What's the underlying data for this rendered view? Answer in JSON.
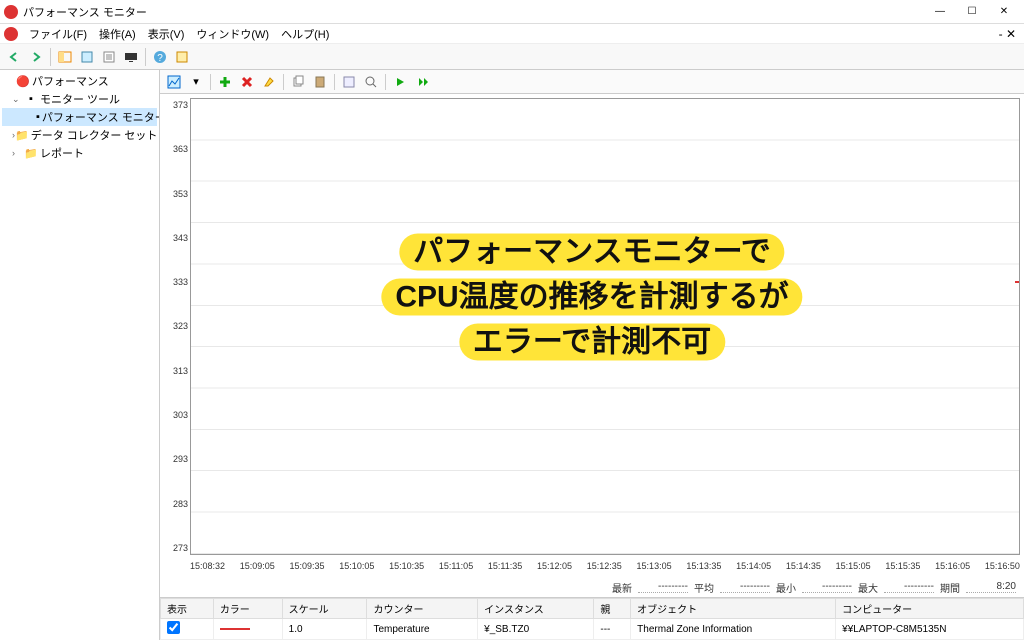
{
  "window": {
    "title": "パフォーマンス モニター"
  },
  "menu": {
    "file": "ファイル(F)",
    "action": "操作(A)",
    "view": "表示(V)",
    "window": "ウィンドウ(W)",
    "help": "ヘルプ(H)"
  },
  "tree": {
    "root": "パフォーマンス",
    "monitor_tools": "モニター ツール",
    "perfmon": "パフォーマンス モニター",
    "collector": "データ コレクター セット",
    "report": "レポート"
  },
  "chart_data": {
    "type": "line",
    "title": "",
    "xlabel": "",
    "ylabel": "",
    "ylim": [
      273,
      373
    ],
    "y_ticks": [
      273,
      283,
      293,
      303,
      313,
      323,
      333,
      343,
      353,
      363,
      373
    ],
    "x_ticks": [
      "15:08:32",
      "15:09:05",
      "15:09:35",
      "15:10:05",
      "15:10:35",
      "15:11:05",
      "15:11:35",
      "15:12:05",
      "15:12:35",
      "15:13:05",
      "15:13:35",
      "15:14:05",
      "15:14:35",
      "15:15:05",
      "15:15:35",
      "15:16:05",
      "15:16:50"
    ],
    "series": [
      {
        "name": "Temperature",
        "values": []
      }
    ]
  },
  "stats": {
    "latest_label": "最新",
    "latest": "---------",
    "avg_label": "平均",
    "avg": "---------",
    "min_label": "最小",
    "min": "---------",
    "max_label": "最大",
    "max": "---------",
    "duration_label": "期間",
    "duration": "8:20"
  },
  "counters": {
    "headers": {
      "show": "表示",
      "color": "カラー",
      "scale": "スケール",
      "counter": "カウンター",
      "instance": "インスタンス",
      "parent": "親",
      "object": "オブジェクト",
      "computer": "コンピューター"
    },
    "row": {
      "checked": true,
      "color": "#d33",
      "scale": "1.0",
      "counter": "Temperature",
      "instance": "¥_SB.TZ0",
      "parent": "---",
      "object": "Thermal Zone Information",
      "computer": "¥¥LAPTOP-C8M5135N"
    }
  },
  "annotation": {
    "line1": "パフォーマンスモニターで",
    "line2": "CPU温度の推移を計測するが",
    "line3": "エラーで計測不可"
  }
}
